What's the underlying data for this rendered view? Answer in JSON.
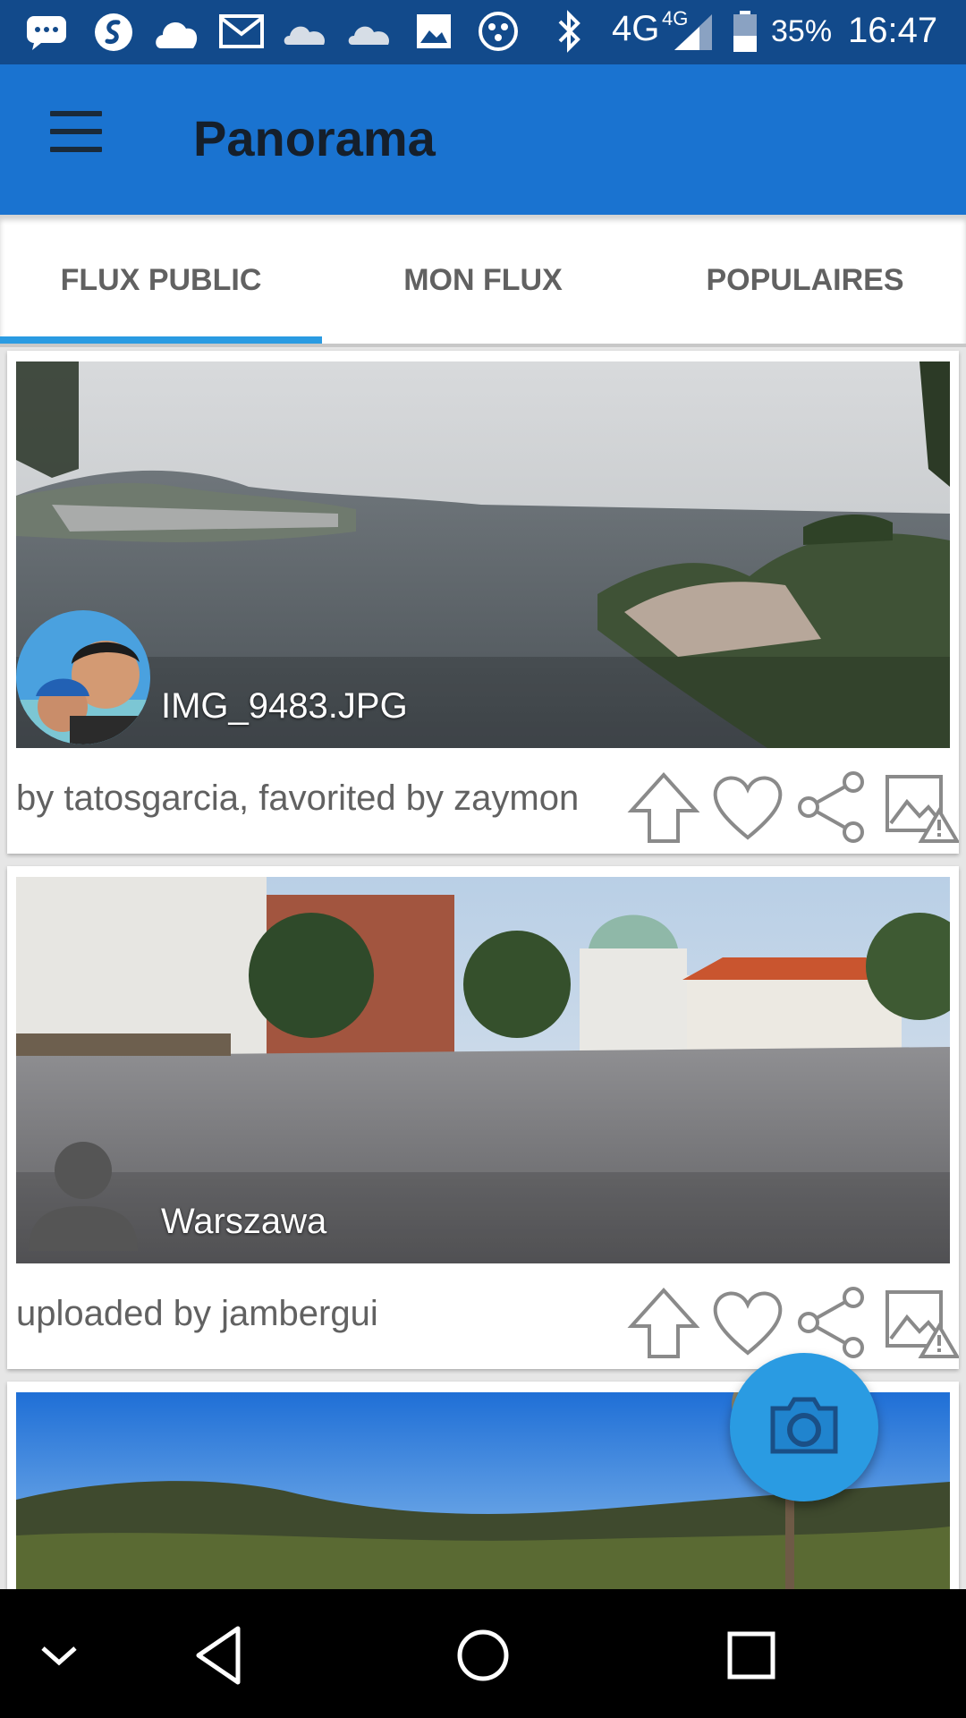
{
  "status_bar": {
    "network": "4G",
    "network_small": "4G",
    "battery": "35%",
    "time": "16:47",
    "icons": [
      "chat-icon",
      "shazam-icon",
      "cloud-icon",
      "gmail-icon",
      "onedrive-icon",
      "onedrive-icon",
      "gallery-icon",
      "game-icon",
      "bluetooth-icon",
      "signal-icon",
      "battery-icon"
    ]
  },
  "app_bar": {
    "title": "Panorama"
  },
  "tabs": [
    {
      "label": "FLUX PUBLIC",
      "selected": true
    },
    {
      "label": "MON FLUX",
      "selected": false
    },
    {
      "label": "POPULAIRES",
      "selected": false
    }
  ],
  "feed": [
    {
      "image_title": "IMG_9483.JPG",
      "caption": "by tatosgarcia, favorited by zaymon",
      "avatar": "user-photo"
    },
    {
      "image_title": "Warszawa",
      "caption": "uploaded by jambergui",
      "avatar": "default-user-silhouette"
    },
    {
      "image_title": "",
      "caption": ""
    }
  ],
  "actions": [
    "upvote-icon",
    "heart-icon",
    "share-icon",
    "report-image-icon"
  ],
  "fab": {
    "icon": "camera-icon"
  },
  "colors": {
    "status_bar": "#124a8b",
    "app_bar": "#1a73d0",
    "accent": "#2a9be2",
    "tab_text": "#616161"
  }
}
